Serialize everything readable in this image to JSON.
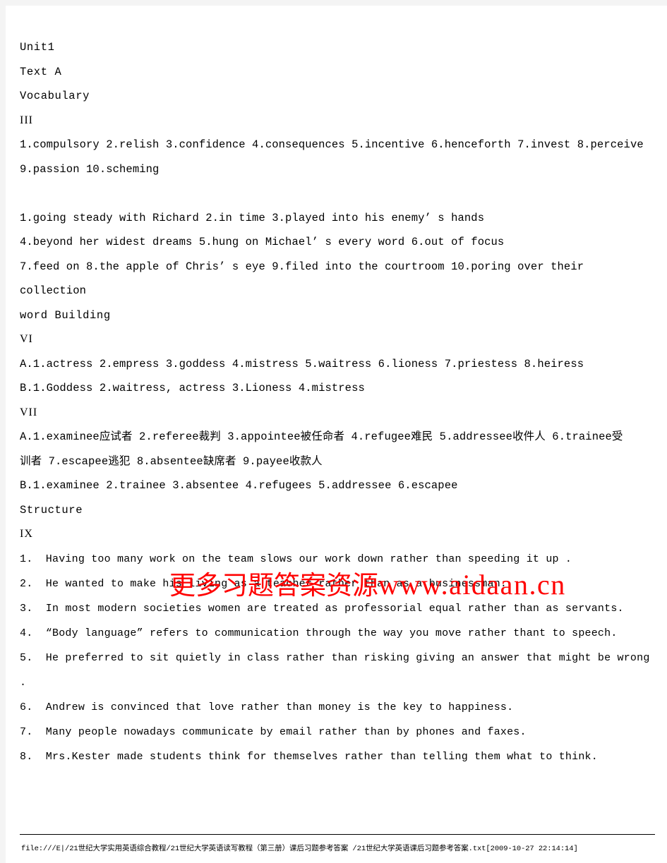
{
  "document": {
    "title": "21世纪大学英语课后习题参考答案",
    "unit": "Unit1",
    "text_label": "Text A",
    "sections": {
      "vocabulary_heading": "Vocabulary",
      "word_building_heading": "word Building",
      "structure_heading": "Structure"
    },
    "numerals": {
      "three": "III",
      "six": "VI",
      "seven": "VII",
      "nine": "IX"
    },
    "vocabulary_III": {
      "line1": "1.compulsory 2.relish 3.confidence 4.consequences 5.incentive 6.henceforth 7.invest 8.perceive",
      "line2": "9.passion 10.scheming"
    },
    "phrases": {
      "line1": "1.going steady with Richard 2.in time 3.played into his enemy’ s hands",
      "line2": "4.beyond her widest dreams 5.hung on Michael’ s every word 6.out of focus",
      "line3": "7.feed on 8.the apple of Chris’ s eye 9.filed into the courtroom 10.poring over their collection"
    },
    "word_building_VI": {
      "a": "A.1.actress 2.empress 3.goddess 4.mistress 5.waitress 6.lioness 7.priestess 8.heiress",
      "b": "B.1.Goddess 2.waitress, actress 3.Lioness 4.mistress"
    },
    "word_building_VII": {
      "a_line1": "A.1.examinee应试者 2.referee裁判 3.appointee被任命者 4.refugee难民 5.addressee收件人 6.trainee受",
      "a_line2": "训者 7.escapee逃犯 8.absentee缺席者 9.payee收款人",
      "b": "B.1.examinee 2.trainee 3.absentee 4.refugees 5.addressee 6.escapee"
    },
    "structure_IX": {
      "items": [
        "1.  Having too many work on the team slows our work down rather than speeding it up .",
        "2.  He wanted to make his living as a teacher rather than as a businessman.",
        "3.  In most modern societies women are treated as professorial equal rather than as servants.",
        "4.  “Body language” refers to communication through the way you move rather thant to speech.",
        "5.  He preferred to sit quietly in class rather than risking giving an answer that might be wrong",
        ".",
        "6.  Andrew is convinced that love rather than money is the key to happiness.",
        "7.  Many people nowadays communicate by email rather than by phones and faxes.",
        "8.  Mrs.Kester made students think for themselves rather than telling them what to think."
      ]
    }
  },
  "watermark": {
    "chinese": "更多习题答案资源",
    "url": "www.aidaan.cn",
    "color": "#ff0000"
  },
  "footer": {
    "path": "file:///E|/21世纪大学实用英语综合教程/21世纪大学英语读写教程（第三册）课后习题参考答案 /21世纪大学英语课后习题参考答案.txt[2009-10-27 22:14:14]"
  }
}
